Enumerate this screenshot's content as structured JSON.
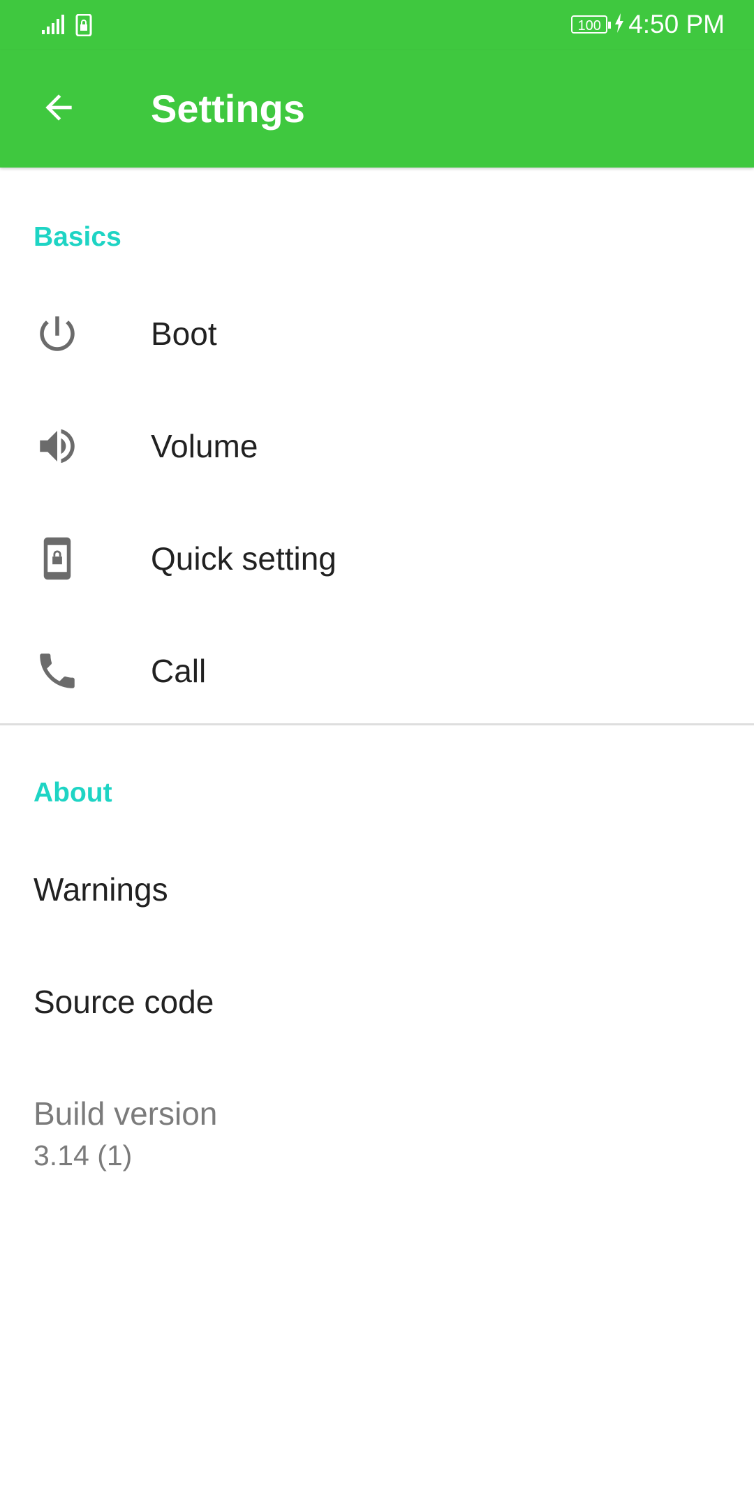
{
  "status_bar": {
    "battery": "100",
    "time": "4:50 PM"
  },
  "app_bar": {
    "title": "Settings",
    "back_icon": "arrow-back-icon"
  },
  "sections": {
    "basics": {
      "header": "Basics",
      "items": [
        {
          "label": "Boot",
          "icon": "power-icon"
        },
        {
          "label": "Volume",
          "icon": "volume-icon"
        },
        {
          "label": "Quick setting",
          "icon": "phone-lock-icon"
        },
        {
          "label": "Call",
          "icon": "phone-icon"
        }
      ]
    },
    "about": {
      "header": "About",
      "items": [
        {
          "label": "Warnings"
        },
        {
          "label": "Source code"
        }
      ],
      "build": {
        "title": "Build version",
        "value": "3.14 (1)"
      }
    }
  },
  "colors": {
    "primary": "#3fc83f",
    "accent": "#1ed4c4",
    "icon": "#6b6b6b",
    "text": "#212121",
    "secondary_text": "#7b7b7b"
  }
}
